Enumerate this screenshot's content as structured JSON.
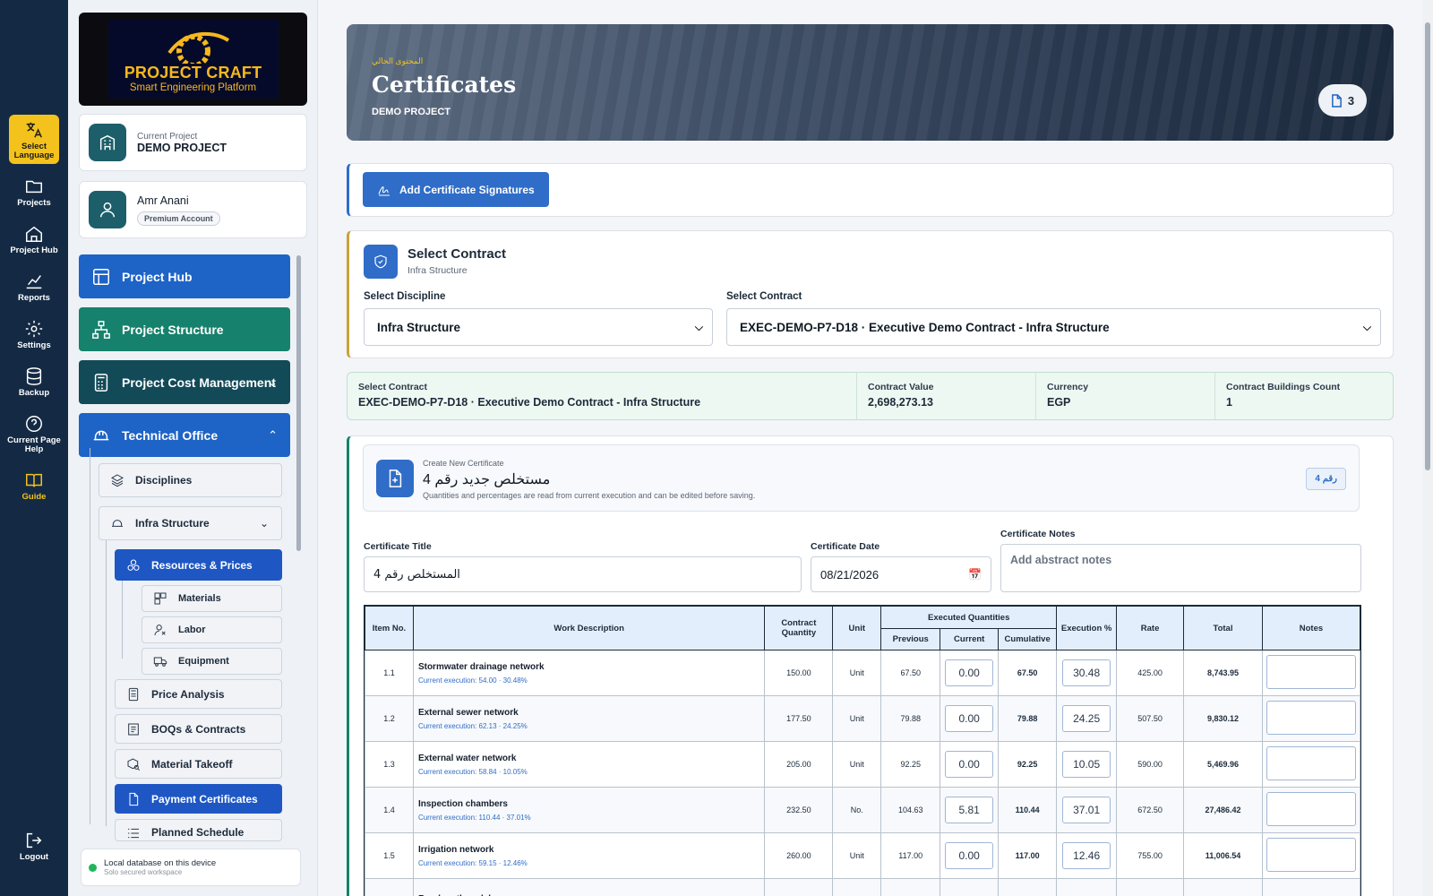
{
  "rail": {
    "items": [
      {
        "label": "Select Language",
        "icon": "translate-icon"
      },
      {
        "label": "Projects",
        "icon": "folder-icon"
      },
      {
        "label": "Project Hub",
        "icon": "home-icon"
      },
      {
        "label": "Reports",
        "icon": "chart-icon"
      },
      {
        "label": "Settings",
        "icon": "gear-icon"
      },
      {
        "label": "Backup",
        "icon": "database-icon"
      },
      {
        "label": "Current Page Help",
        "icon": "help-icon"
      },
      {
        "label": "Guide",
        "icon": "book-icon"
      }
    ],
    "logout": "Logout"
  },
  "logo": {
    "name": "PROJECT CRAFT",
    "tagline": "Smart Engineering Platform"
  },
  "project_card": {
    "label": "Current Project",
    "value": "DEMO PROJECT"
  },
  "user_card": {
    "name": "Amr Anani",
    "badge": "Premium Account"
  },
  "nav": {
    "project_hub": "Project Hub",
    "project_structure": "Project Structure",
    "cost_management": "Project Cost Management",
    "technical_office": "Technical Office",
    "disciplines": "Disciplines",
    "infra_structure": "Infra Structure",
    "resources_prices": "Resources & Prices",
    "materials": "Materials",
    "labor": "Labor",
    "equipment": "Equipment",
    "price_analysis": "Price Analysis",
    "boqs_contracts": "BOQs & Contracts",
    "material_takeoff": "Material Takeoff",
    "payment_certificates": "Payment Certificates",
    "planned_schedule": "Planned Schedule"
  },
  "db_status": {
    "title": "Local database on this device",
    "subtitle": "Solo secured workspace"
  },
  "hero": {
    "arabic_label": "المحتوى الحالي",
    "title": "Certificates",
    "subtitle": "DEMO PROJECT",
    "count": "3"
  },
  "actions": {
    "add_signatures": "Add Certificate Signatures"
  },
  "contract_select": {
    "title": "Select Contract",
    "subtitle": "Infra Structure",
    "discipline_label": "Select Discipline",
    "discipline_value": "Infra Structure",
    "contract_label": "Select Contract",
    "contract_value": "EXEC-DEMO-P7-D18 · Executive Demo Contract - Infra Structure"
  },
  "contract_info": {
    "contract_label": "Select Contract",
    "contract_value": "EXEC-DEMO-P7-D18 · Executive Demo Contract - Infra Structure",
    "value_label": "Contract Value",
    "value": "2,698,273.13",
    "currency_label": "Currency",
    "currency": "EGP",
    "buildings_label": "Contract Buildings Count",
    "buildings": "1"
  },
  "new_certificate": {
    "small": "Create New Certificate",
    "title": "مستخلص جديد رقم 4",
    "description": "Quantities and percentages are read from current execution and can be edited before saving.",
    "badge": "رقم 4",
    "title_label": "Certificate Title",
    "title_value": "المستخلص رقم 4",
    "date_label": "Certificate Date",
    "date_value": "08/21/2026",
    "notes_label": "Certificate Notes",
    "notes_placeholder": "Add abstract notes"
  },
  "table": {
    "headers": {
      "item_no": "Item No.",
      "work_description": "Work Description",
      "contract_quantity": "Contract Quantity",
      "unit": "Unit",
      "executed": "Executed Quantities",
      "previous": "Previous",
      "current": "Current",
      "cumulative": "Cumulative",
      "execution_pct": "Execution %",
      "rate": "Rate",
      "total": "Total",
      "notes": "Notes"
    },
    "rows": [
      {
        "item": "1.1",
        "desc": "Stormwater drainage network",
        "sub": "Current execution: 54.00 · 30.48%",
        "qty": "150.00",
        "unit": "Unit",
        "prev": "67.50",
        "cur": "0.00",
        "cum": "67.50",
        "pct": "30.48",
        "rate": "425.00",
        "total": "8,743.95"
      },
      {
        "item": "1.2",
        "desc": "External sewer network",
        "sub": "Current execution: 62.13 · 24.25%",
        "qty": "177.50",
        "unit": "Unit",
        "prev": "79.88",
        "cur": "0.00",
        "cum": "79.88",
        "pct": "24.25",
        "rate": "507.50",
        "total": "9,830.12"
      },
      {
        "item": "1.3",
        "desc": "External water network",
        "sub": "Current execution: 58.84 · 10.05%",
        "qty": "205.00",
        "unit": "Unit",
        "prev": "92.25",
        "cur": "0.00",
        "cum": "92.25",
        "pct": "10.05",
        "rate": "590.00",
        "total": "5,469.96"
      },
      {
        "item": "1.4",
        "desc": "Inspection chambers",
        "sub": "Current execution: 110.44 · 37.01%",
        "qty": "232.50",
        "unit": "No.",
        "prev": "104.63",
        "cur": "5.81",
        "cum": "110.44",
        "pct": "37.01",
        "rate": "672.50",
        "total": "27,486.42"
      },
      {
        "item": "1.5",
        "desc": "Irrigation network",
        "sub": "Current execution: 59.15 · 12.46%",
        "qty": "260.00",
        "unit": "Unit",
        "prev": "117.00",
        "cur": "0.00",
        "cum": "117.00",
        "pct": "12.46",
        "rate": "755.00",
        "total": "11,006.54"
      },
      {
        "item": "",
        "desc": "Road earthwork layers",
        "sub": "",
        "qty": "",
        "unit": "",
        "prev": "",
        "cur": "",
        "cum": "",
        "pct": "",
        "rate": "",
        "total": ""
      }
    ]
  }
}
